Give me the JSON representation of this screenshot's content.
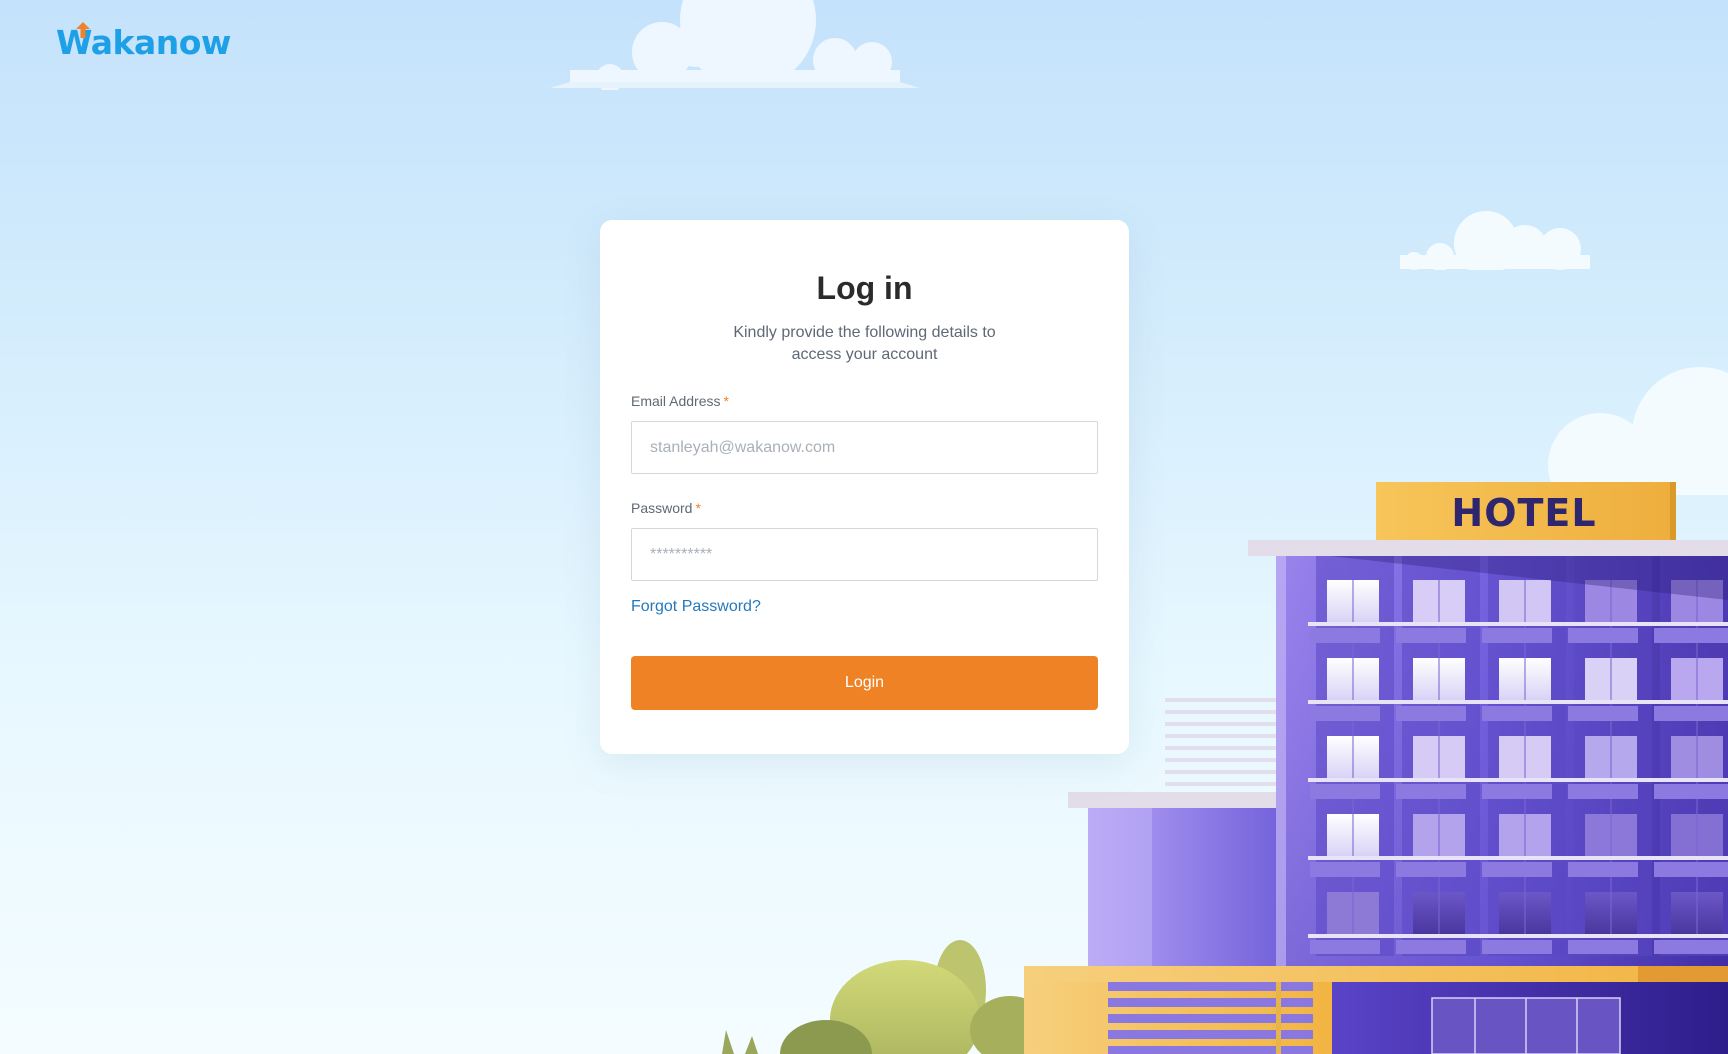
{
  "brand": {
    "name": "Wakanow"
  },
  "login": {
    "title": "Log in",
    "subtitle_line1": "Kindly provide the following details to",
    "subtitle_line2": "access your account",
    "email_label": "Email Address",
    "email_required": "*",
    "email_placeholder": "stanleyah@wakanow.com",
    "password_label": "Password",
    "password_required": "*",
    "password_placeholder": "**********",
    "forgot_password": "Forgot Password?",
    "login_button": "Login"
  },
  "illustration": {
    "sign_text": "HOTEL"
  },
  "colors": {
    "brand_blue": "#1ea0e6",
    "accent_orange": "#f08226",
    "link_blue": "#2479bd",
    "building_purple": "#6b55d6",
    "sign_yellow": "#f3b843"
  }
}
